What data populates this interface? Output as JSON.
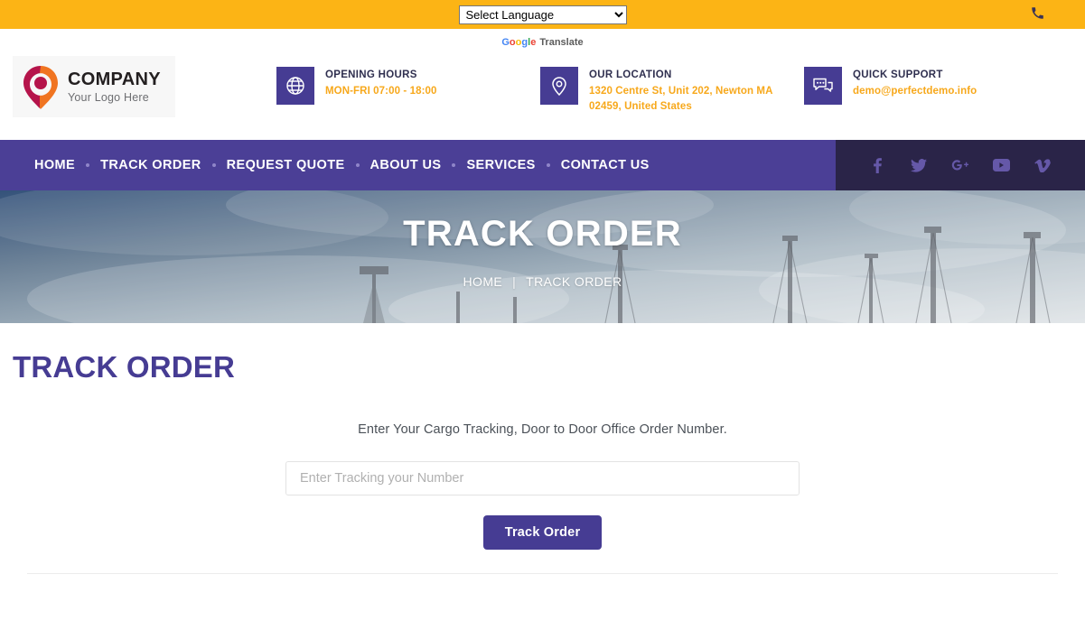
{
  "topbar": {
    "language_selected": "Select Language",
    "language_options": [
      "Select Language"
    ],
    "phone_icon": "phone-icon",
    "translate_brand": "Google",
    "translate_word": "Translate"
  },
  "header": {
    "logo": {
      "title": "COMPANY",
      "subtitle": "Your Logo Here",
      "icon": "map-pin-logo-icon"
    },
    "info": [
      {
        "icon": "globe-icon",
        "title": "OPENING HOURS",
        "value": "MON-FRI 07:00 - 18:00"
      },
      {
        "icon": "location-pin-icon",
        "title": "OUR LOCATION",
        "value": "1320 Centre St, Unit 202, Newton MA 02459, United States"
      },
      {
        "icon": "chat-bubbles-icon",
        "title": "QUICK SUPPORT",
        "value": "demo@perfectdemo.info"
      }
    ]
  },
  "nav": {
    "items": [
      {
        "label": "HOME"
      },
      {
        "label": "TRACK ORDER"
      },
      {
        "label": "REQUEST QUOTE"
      },
      {
        "label": "ABOUT US"
      },
      {
        "label": "SERVICES"
      },
      {
        "label": "CONTACT US"
      }
    ],
    "socials": [
      {
        "name": "facebook-icon",
        "glyph": "f"
      },
      {
        "name": "twitter-icon",
        "glyph": "ᴠ"
      },
      {
        "name": "google-plus-icon",
        "glyph": "g⁺"
      },
      {
        "name": "youtube-icon",
        "glyph": "▶"
      },
      {
        "name": "vimeo-icon",
        "glyph": "V"
      }
    ]
  },
  "hero": {
    "title": "TRACK ORDER",
    "breadcrumb": {
      "home": "HOME",
      "separator": "|",
      "current": "TRACK ORDER"
    }
  },
  "main": {
    "page_title": "TRACK ORDER",
    "note": "Enter Your Cargo Tracking, Door to Door Office Order Number.",
    "input_placeholder": "Enter Tracking your Number",
    "input_value": "",
    "button_label": "Track Order"
  },
  "colors": {
    "topbar_yellow": "#fcb415",
    "brand_purple": "#463c93",
    "nav_purple": "#4b3f96",
    "nav_dark": "#2a2448",
    "accent_orange": "#f7a81b"
  }
}
